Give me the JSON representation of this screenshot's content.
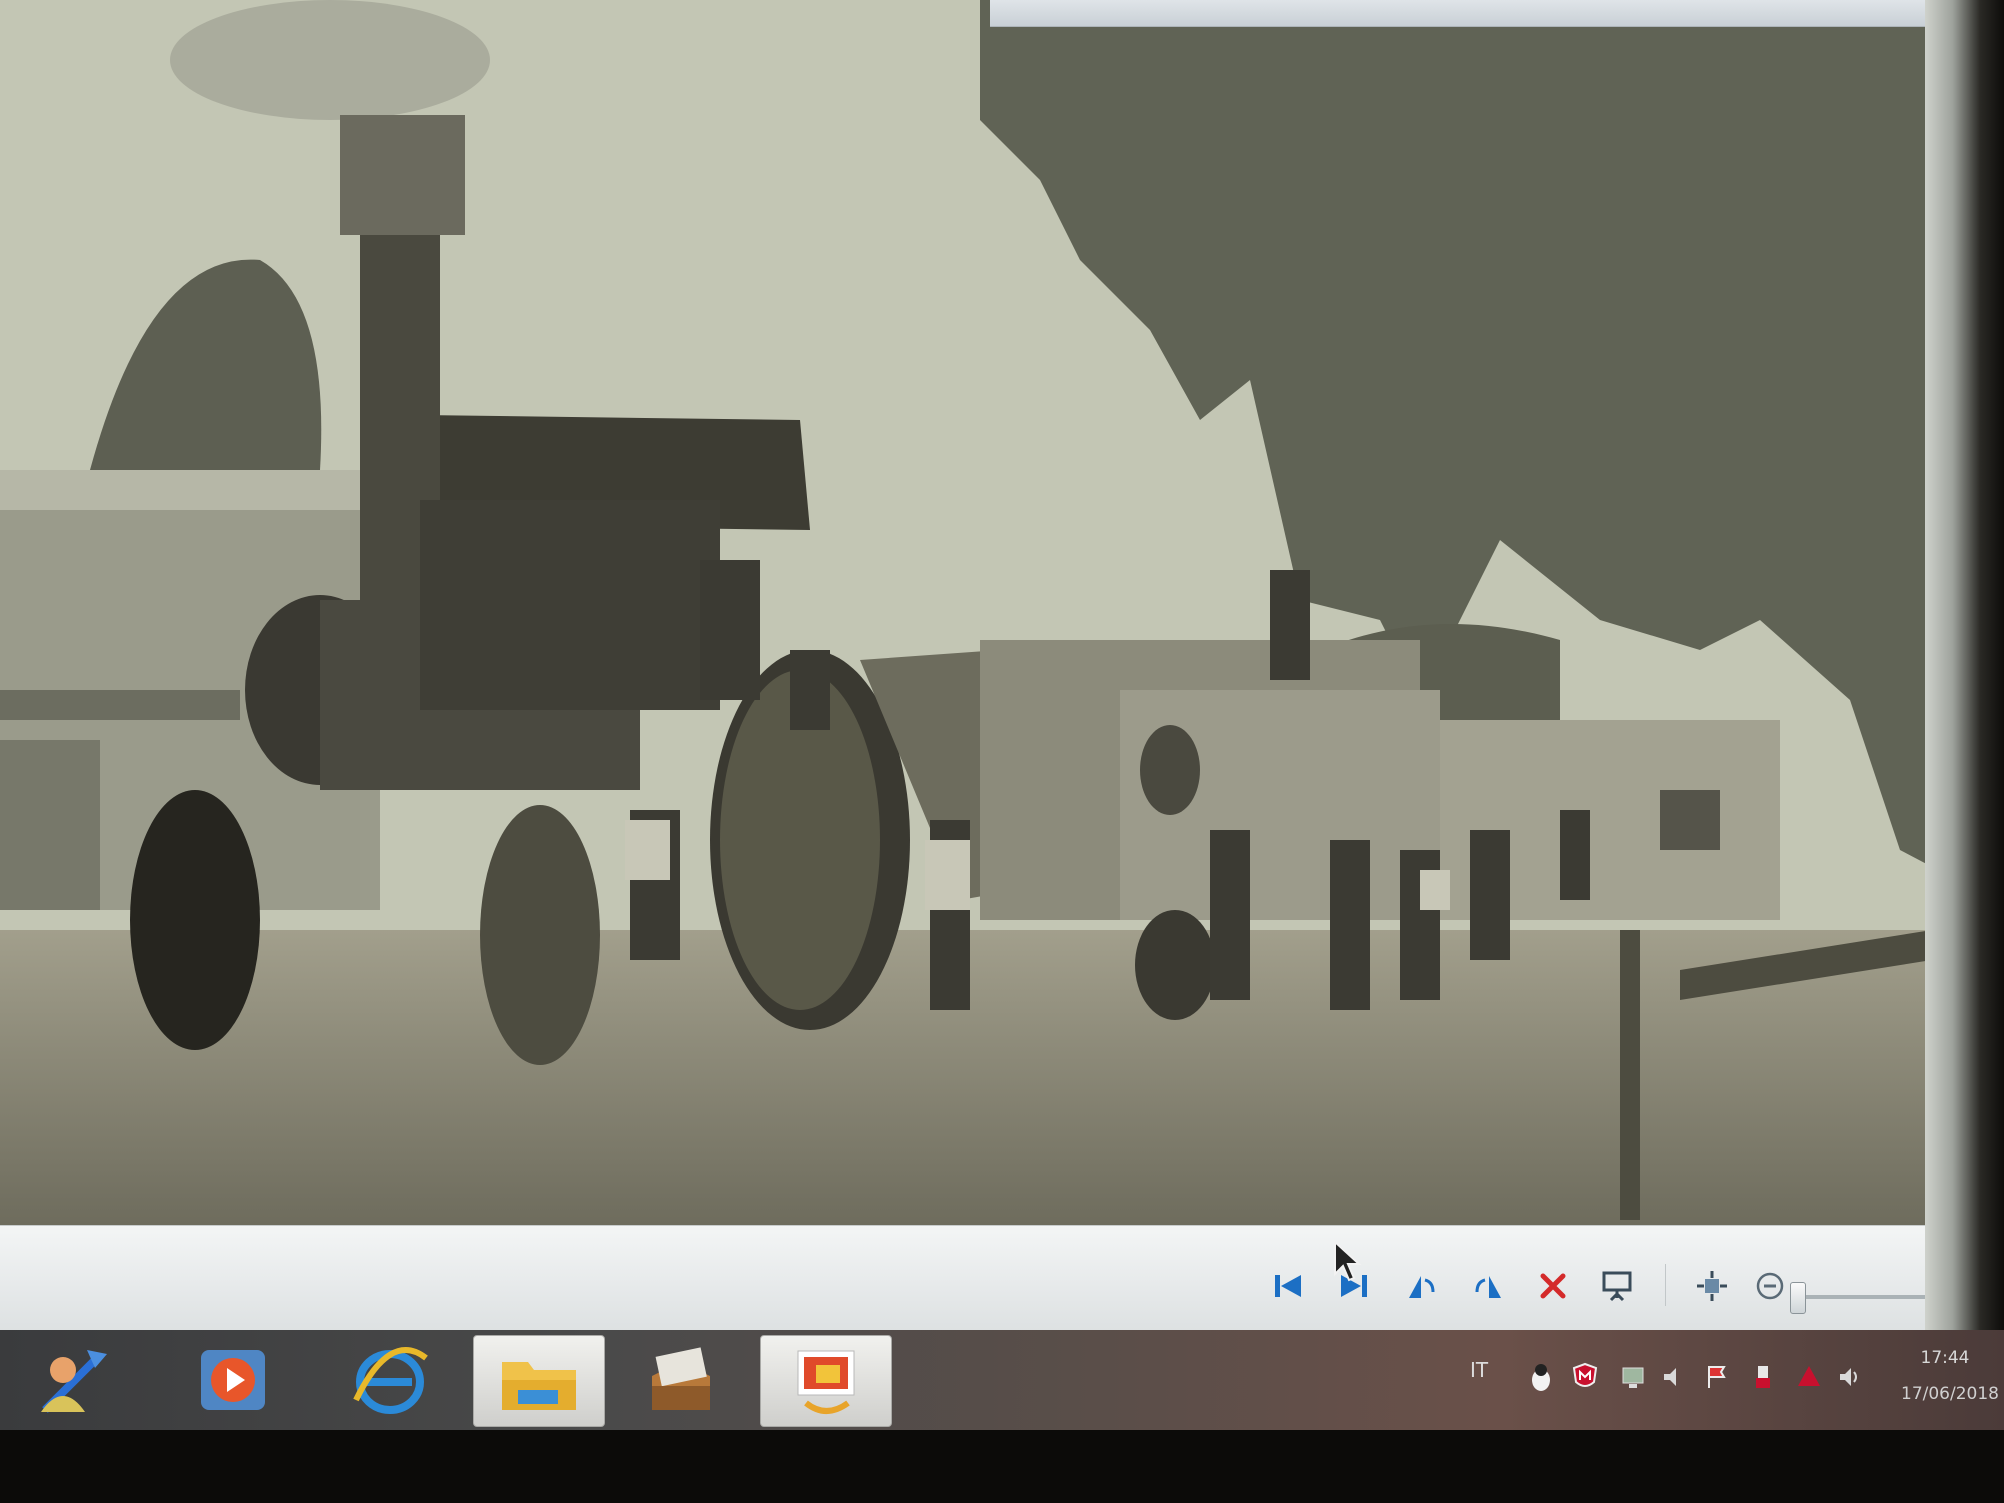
{
  "photo": {
    "subject": "Historic sepia photograph of a steam traction engine and threshing machine with workers"
  },
  "toolbar": {
    "buttons": [
      {
        "name": "previous-button",
        "icon": "skip-back-icon"
      },
      {
        "name": "play-slideshow-button",
        "icon": "skip-forward-icon"
      },
      {
        "name": "rotate-left-button",
        "icon": "rotate-left-icon"
      },
      {
        "name": "rotate-right-button",
        "icon": "rotate-right-icon"
      },
      {
        "name": "delete-button",
        "icon": "red-x-icon"
      },
      {
        "name": "slideshow-button",
        "icon": "projector-icon"
      },
      {
        "name": "actual-size-button",
        "icon": "fit-to-window-icon"
      },
      {
        "name": "zoom-out-button",
        "icon": "minus-circle-icon"
      },
      {
        "name": "zoom-in-button",
        "icon": "plus-circle-icon"
      }
    ],
    "zoom_level": 0.05
  },
  "taskbar": {
    "apps": [
      {
        "name": "start-button",
        "icon": "user-start-icon"
      },
      {
        "name": "media-player-button",
        "icon": "play-icon"
      },
      {
        "name": "internet-explorer-button",
        "icon": "ie-icon"
      },
      {
        "name": "file-explorer-button",
        "icon": "folder-icon"
      },
      {
        "name": "file-cabinet-button",
        "icon": "cabinet-icon"
      },
      {
        "name": "photo-viewer-button",
        "icon": "photo-viewer-icon"
      }
    ],
    "language": "IT",
    "clock": {
      "time": "17:44",
      "date": "17/06/2018"
    }
  },
  "colors": {
    "photo_sepia": "#b9bcab",
    "toolbar_bg": "#e9eae4",
    "taskbar_bg": "#4a4a4a",
    "delete_red": "#d42a2a",
    "nav_blue": "#1c6fc4"
  }
}
